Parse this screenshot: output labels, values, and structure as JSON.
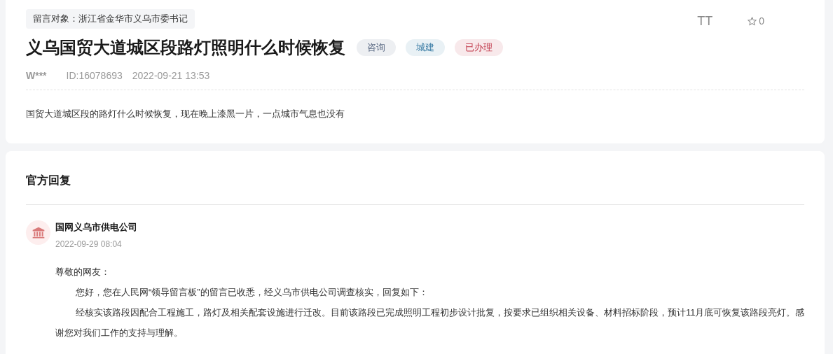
{
  "target": "留言对象：浙江省金华市义乌市委书记",
  "title": "义乌国贸大道城区段路灯照明什么时候恢复",
  "tags": [
    {
      "label": "咨询",
      "color": "#5c6b85"
    },
    {
      "label": "城建",
      "color": "#3a7ca5"
    },
    {
      "label": "已办理",
      "color": "#c0394b"
    }
  ],
  "font_size_button": "TT",
  "favorites": {
    "count": "0"
  },
  "author": "W***",
  "id": "ID:16078693",
  "time": "2022-09-21 13:53",
  "content": "国贸大道城区段的路灯什么时候恢复，现在晚上漆黑一片，一点城市气息也没有",
  "reply_section": {
    "heading": "官方回复",
    "replier": "国网义乌市供电公司",
    "time": "2022-09-29 08:04",
    "salutation": "尊敬的网友：",
    "paragraphs": [
      "您好，您在人民网“领导留言板”的留言已收悉，经义乌市供电公司调查核实，回复如下：",
      "经核实该路段因配合工程施工，路灯及相关配套设施进行迁改。目前该路段已完成照明工程初步设计批复，按要求已组织相关设备、材料招标阶段，预计11月底可恢复该路段亮灯。感谢您对我们工作的支持与理解。"
    ]
  }
}
